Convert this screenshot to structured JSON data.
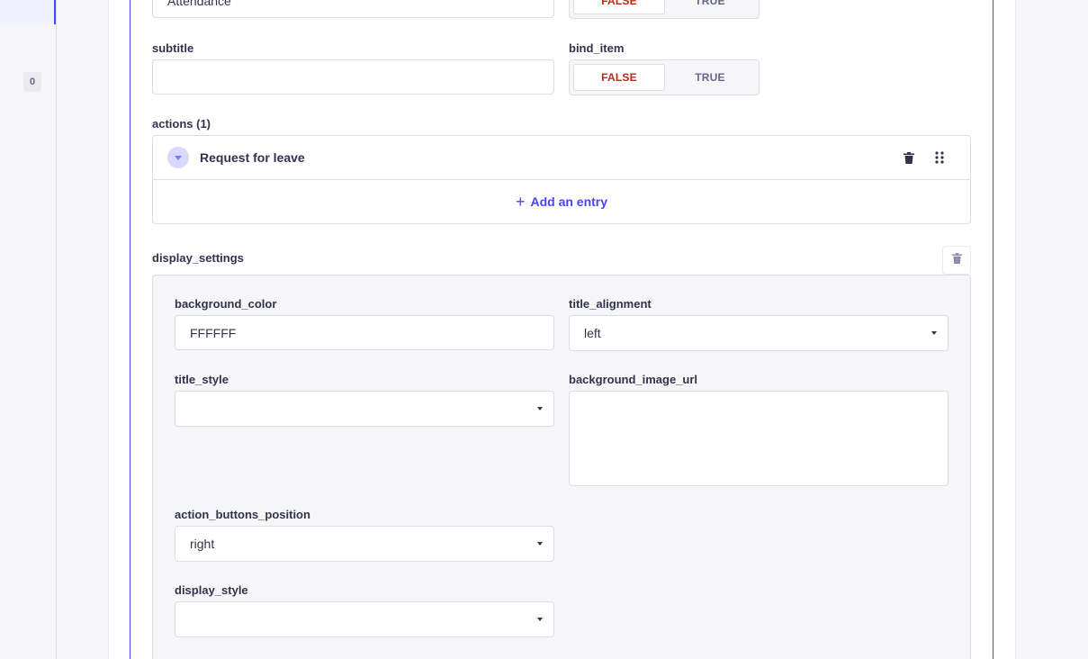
{
  "rail": {
    "badge": "0"
  },
  "fields": {
    "title_value": "Attendance",
    "title_required_toggle": {
      "false_label": "FALSE",
      "true_label": "TRUE",
      "selected": "FALSE"
    },
    "subtitle_label": "subtitle",
    "subtitle_value": "",
    "bind_item_label": "bind_item",
    "bind_item_toggle": {
      "false_label": "FALSE",
      "true_label": "TRUE",
      "selected": "FALSE"
    }
  },
  "actions": {
    "label": "actions (1)",
    "entries": [
      {
        "title": "Request for leave"
      }
    ],
    "add_label": "Add an entry"
  },
  "display_settings": {
    "label": "display_settings",
    "background_color_label": "background_color",
    "background_color_value": "FFFFFF",
    "title_alignment_label": "title_alignment",
    "title_alignment_value": "left",
    "title_style_label": "title_style",
    "title_style_value": "",
    "background_image_url_label": "background_image_url",
    "background_image_url_value": "",
    "action_buttons_position_label": "action_buttons_position",
    "action_buttons_position_value": "right",
    "display_style_label": "display_style",
    "display_style_value": ""
  },
  "colors": {
    "primary": "#4945ff",
    "danger_text": "#b72b1a",
    "neutral_bg": "#f6f6f9",
    "border": "#dcdce4"
  },
  "icons": [
    "trash-icon",
    "drag-handle-icon",
    "chevron-down-icon",
    "plus-icon"
  ]
}
